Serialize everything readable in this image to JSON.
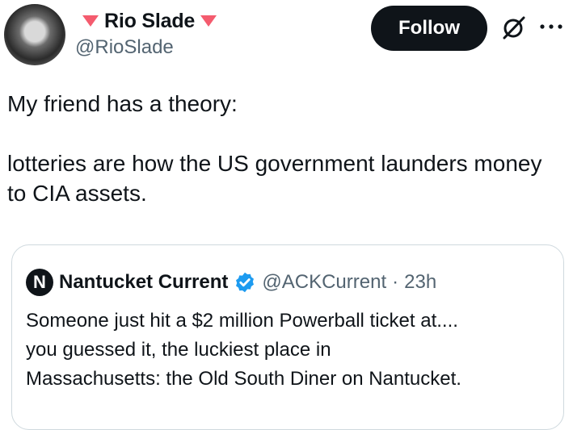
{
  "author": {
    "name": "Rio Slade",
    "handle": "@RioSlade",
    "name_decoration_color": "#f45b6e"
  },
  "follow_button": {
    "label": "Follow"
  },
  "icons": [
    "avatar",
    "grok-icon",
    "more-options-icon",
    "verified-badge-icon"
  ],
  "tweet": {
    "text": "My friend has a theory:\n\nlotteries are how the US government launders money to CIA assets."
  },
  "quoted_tweet": {
    "avatar_letter": "N",
    "name": "Nantucket Current",
    "handle": "@ACKCurrent",
    "separator": "·",
    "time": "23h",
    "text": "Someone just hit a $2 million Powerball ticket at....\nyou guessed it, the luckiest place in\nMassachusetts: the Old South Diner on Nantucket."
  },
  "colors": {
    "text": "#0f1419",
    "secondary_text": "#536471",
    "follow_bg": "#0f1419",
    "verified": "#1d9bf0",
    "border": "#cfd9de"
  }
}
